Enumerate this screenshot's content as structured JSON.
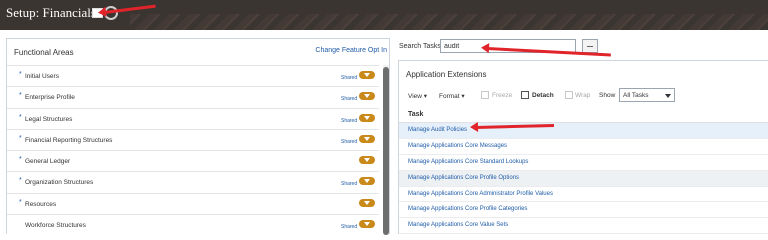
{
  "header": {
    "title": "Setup: Financials"
  },
  "functional_areas": {
    "title": "Functional Areas",
    "feature_link": "Change Feature Opt In",
    "shared_label": "Shared",
    "items": [
      {
        "label": "Initial Users",
        "required": true,
        "shared": true
      },
      {
        "label": "Enterprise Profile",
        "required": true,
        "shared": true
      },
      {
        "label": "Legal Structures",
        "required": true,
        "shared": true
      },
      {
        "label": "Financial Reporting Structures",
        "required": true,
        "shared": true
      },
      {
        "label": "General Ledger",
        "required": true,
        "shared": false
      },
      {
        "label": "Organization Structures",
        "required": true,
        "shared": true
      },
      {
        "label": "Resources",
        "required": true,
        "shared": false
      },
      {
        "label": "Workforce Structures",
        "required": false,
        "shared": true
      }
    ]
  },
  "search": {
    "label": "Search Tasks",
    "value": "audit"
  },
  "app_extensions": {
    "title": "Application Extensions",
    "toolbar": {
      "view": "View",
      "format": "Format",
      "freeze": "Freeze",
      "detach": "Detach",
      "wrap": "Wrap",
      "show_label": "Show",
      "show_value": "All Tasks"
    },
    "column_header": "Task",
    "tasks": [
      "Manage Audit Policies",
      "Manage Applications Core Messages",
      "Manage Applications Core Standard Lookups",
      "Manage Applications Core Profile Options",
      "Manage Applications Core Administrator Profile Values",
      "Manage Applications Core Profile Categories",
      "Manage Applications Core Value Sets"
    ]
  },
  "colors": {
    "header_bg": "#3b3532",
    "link": "#1f5ca8",
    "pill": "#c98a1b",
    "annotation_arrow": "#e0242a"
  }
}
